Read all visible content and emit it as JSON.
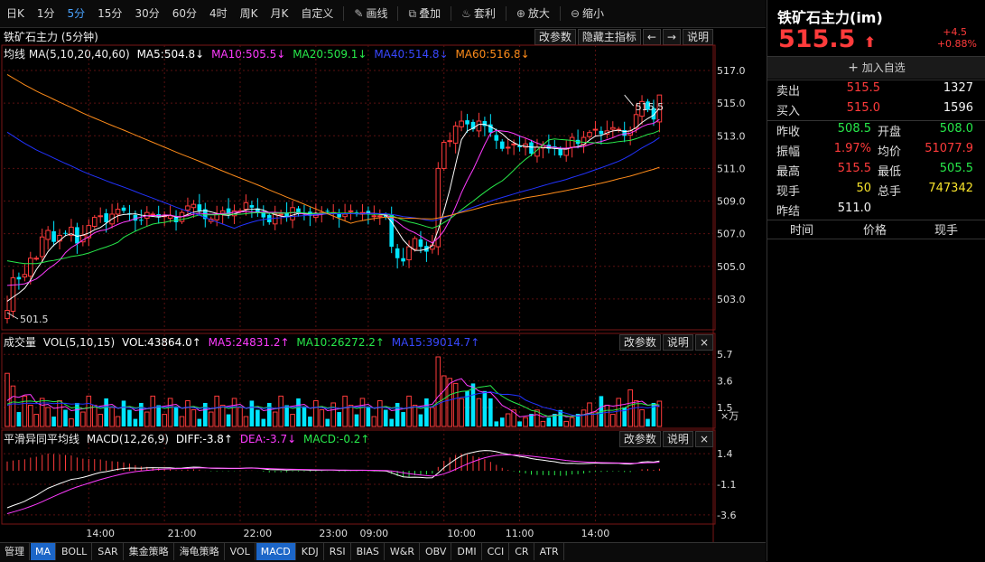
{
  "toolbar": {
    "items": [
      "日K",
      "1分",
      "5分",
      "15分",
      "30分",
      "60分",
      "4时",
      "周K",
      "月K",
      "自定义"
    ],
    "active": "5分",
    "tools": [
      {
        "icon": "draw-line-icon",
        "glyph": "✎",
        "label": "画线"
      },
      {
        "icon": "overlay-icon",
        "glyph": "⧉",
        "label": "叠加"
      },
      {
        "icon": "arbitrage-icon",
        "glyph": "♨",
        "label": "套利"
      },
      {
        "icon": "zoom-in-icon",
        "glyph": "⊕",
        "label": "放大"
      },
      {
        "icon": "zoom-out-icon",
        "glyph": "⊖",
        "label": "缩小"
      }
    ]
  },
  "price_panel": {
    "title": "铁矿石主力 (5分钟)",
    "ma_prefix": "均线",
    "ma_params": "MA(5,10,20,40,60)",
    "ma5": "MA5:504.8↓",
    "ma10": "MA10:505.5↓",
    "ma20": "MA20:509.1↓",
    "ma40": "MA40:514.8↓",
    "ma60": "MA60:516.8↓",
    "high_mark": "515.5",
    "low_mark": "501.5",
    "buttons": [
      "改参数",
      "隐藏主指标",
      "←",
      "→",
      "说明"
    ]
  },
  "vol_panel": {
    "title": "成交量",
    "params": "VOL(5,10,15)",
    "vol": "VOL:43864.0↑",
    "ma5": "MA5:24831.2↑",
    "ma10": "MA10:26272.2↑",
    "ma15": "MA15:39014.7↑",
    "unit": "×万",
    "buttons": [
      "改参数",
      "说明",
      "×"
    ]
  },
  "macd_panel": {
    "title": "平滑异同平均线",
    "params": "MACD(12,26,9)",
    "diff": "DIFF:-3.8↑",
    "dea": "DEA:-3.7↓",
    "macd": "MACD:-0.2↑",
    "buttons": [
      "改参数",
      "说明",
      "×"
    ]
  },
  "chart_data": [
    {
      "type": "candlestick",
      "title": "铁矿石主力 (5分钟)",
      "y_axis_ticks": [
        517.0,
        515.0,
        513.0,
        511.0,
        509.0,
        507.0,
        505.0,
        503.0
      ],
      "ylim": [
        501.5,
        517.5
      ],
      "x_axis_ticks": [
        "14:00",
        "21:00",
        "22:00",
        "23:00",
        "09:00",
        "10:00",
        "11:00",
        "14:00"
      ],
      "grid": true,
      "close": [
        502.3,
        504.3,
        504.2,
        504.5,
        505.5,
        505.5,
        506.8,
        507.2,
        506.5,
        506.9,
        507.0,
        507.4,
        506.4,
        506.9,
        507.5,
        508.0,
        508.1,
        507.7,
        508.2,
        508.5,
        508.4,
        508.2,
        507.8,
        507.8,
        508.3,
        508.2,
        508.0,
        508.1,
        508.1,
        507.7,
        508.3,
        508.7,
        508.8,
        508.4,
        507.9,
        507.9,
        508.2,
        508.4,
        508.2,
        508.4,
        508.4,
        508.9,
        508.6,
        508.3,
        508.0,
        507.7,
        508.2,
        508.2,
        508.0,
        508.6,
        508.2,
        508.2,
        508.1,
        508.2,
        508.3,
        508.4,
        508.3,
        508.0,
        508.2,
        508.4,
        508.2,
        508.3,
        508.2,
        508.1,
        508.1,
        508.0,
        506.2,
        505.5,
        505.3,
        506.2,
        506.7,
        506.2,
        505.9,
        506.3,
        511.0,
        512.6,
        512.7,
        513.6,
        513.9,
        513.7,
        513.4,
        513.9,
        513.6,
        513.2,
        512.7,
        512.2,
        512.3,
        512.5,
        512.3,
        512.5,
        511.9,
        512.3,
        512.4,
        512.2,
        512.3,
        511.8,
        512.2,
        512.9,
        512.5,
        512.9,
        513.2,
        513.4,
        513.1,
        513.3,
        513.5,
        513.4,
        513.0,
        513.3,
        514.3,
        515.1,
        514.6,
        514.0,
        515.5
      ]
    },
    {
      "type": "bar",
      "title": "成交量",
      "y_axis_ticks": [
        5.7,
        3.6,
        1.5
      ],
      "unit": "×万"
    },
    {
      "type": "line",
      "title": "平滑异同平均线",
      "y_axis_ticks": [
        1.4,
        -1.1,
        -3.6
      ]
    }
  ],
  "quote": {
    "name": "铁矿石主力(im)",
    "price": "515.5",
    "arrow": "⬆",
    "change": "+4.5",
    "change_pct": "+0.88%",
    "add_watch": "加入自选",
    "sell": {
      "label": "卖出",
      "price": "515.5",
      "qty": "1327"
    },
    "buy": {
      "label": "买入",
      "price": "515.0",
      "qty": "1596"
    },
    "stats": [
      [
        {
          "l": "昨收",
          "v": "508.5",
          "c": "green"
        },
        {
          "l": "开盘",
          "v": "508.0",
          "c": "green"
        }
      ],
      [
        {
          "l": "振幅",
          "v": "1.97%",
          "c": "red"
        },
        {
          "l": "均价",
          "v": "51077.9",
          "c": "red"
        }
      ],
      [
        {
          "l": "最高",
          "v": "515.5",
          "c": "red"
        },
        {
          "l": "最低",
          "v": "505.5",
          "c": "green"
        }
      ],
      [
        {
          "l": "现手",
          "v": "50",
          "c": "yellow"
        },
        {
          "l": "总手",
          "v": "747342",
          "c": "yellow"
        }
      ],
      [
        {
          "l": "昨结",
          "v": "511.0",
          "c": "white"
        }
      ]
    ],
    "ticks_headers": [
      "时间",
      "价格",
      "现手"
    ]
  },
  "bottom_tabs": [
    "管理",
    "MA",
    "BOLL",
    "SAR",
    "集金策略",
    "海龟策略",
    "VOL",
    "MACD",
    "KDJ",
    "RSI",
    "BIAS",
    "W&R",
    "OBV",
    "DMI",
    "CCI",
    "CR",
    "ATR"
  ],
  "bottom_tabs_active": [
    "MA",
    "MACD"
  ],
  "colors": {
    "up": "#ff3b3b",
    "down": "#00e5ff",
    "ma5": "#ffffff",
    "ma10": "#ff3bff",
    "ma20": "#27e94a",
    "ma40": "#2233ff",
    "ma60": "#ff8c1a"
  }
}
